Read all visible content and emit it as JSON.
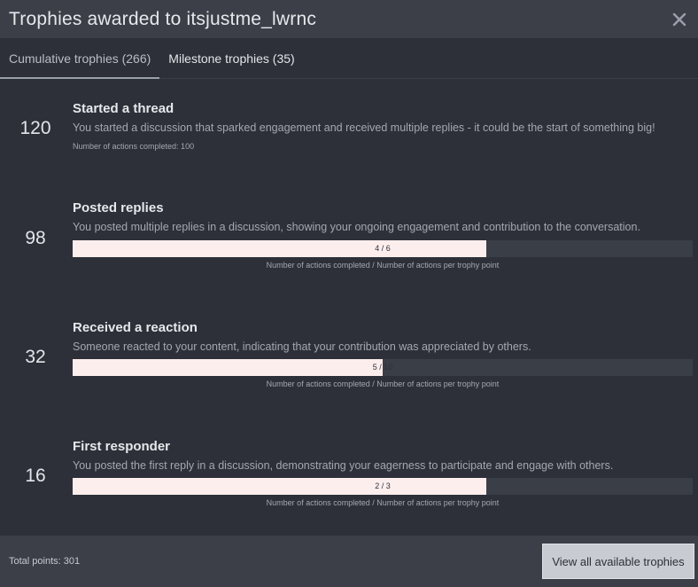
{
  "header": {
    "title": "Trophies awarded to itsjustme_lwrnc",
    "close_icon": "close-icon"
  },
  "tabs": [
    {
      "label": "Cumulative trophies (266)",
      "active": true
    },
    {
      "label": "Milestone trophies (35)",
      "active": false
    }
  ],
  "trophies": [
    {
      "points": "120",
      "name": "Started a thread",
      "description": "You started a discussion that sparked engagement and received multiple replies - it could be the start of something big!",
      "note": "Number of actions completed: 100"
    },
    {
      "points": "98",
      "name": "Posted replies",
      "description": "You posted multiple replies in a discussion, showing your ongoing engagement and contribution to the conversation.",
      "progress_text": "4 / 6",
      "progress_fraction": 0.6667,
      "note": "Number of actions completed / Number of actions per trophy point"
    },
    {
      "points": "32",
      "name": "Received a reaction",
      "description": "Someone reacted to your content, indicating that your contribution was appreciated by others.",
      "progress_text": "5 / 10",
      "progress_fraction": 0.5,
      "note": "Number of actions completed / Number of actions per trophy point"
    },
    {
      "points": "16",
      "name": "First responder",
      "description": "You posted the first reply in a discussion, demonstrating your eagerness to participate and engage with others.",
      "progress_text": "2 / 3",
      "progress_fraction": 0.6667,
      "note": "Number of actions completed / Number of actions per trophy point"
    }
  ],
  "footer": {
    "total": "Total points: 301",
    "view_all_label": "View all available trophies"
  },
  "colors": {
    "background": "#2d3038",
    "header": "#3c3f48",
    "progress_fill": "#fdeeee",
    "progress_track": "#3a3e47"
  }
}
